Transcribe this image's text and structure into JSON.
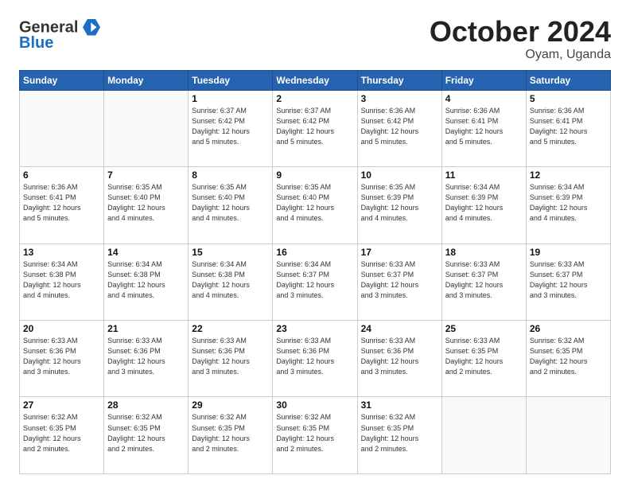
{
  "logo": {
    "text_general": "General",
    "text_blue": "Blue"
  },
  "header": {
    "month": "October 2024",
    "location": "Oyam, Uganda"
  },
  "days_of_week": [
    "Sunday",
    "Monday",
    "Tuesday",
    "Wednesday",
    "Thursday",
    "Friday",
    "Saturday"
  ],
  "weeks": [
    [
      {
        "day": "",
        "empty": true
      },
      {
        "day": "",
        "empty": true
      },
      {
        "day": "1",
        "sunrise": "Sunrise: 6:37 AM",
        "sunset": "Sunset: 6:42 PM",
        "daylight": "Daylight: 12 hours and 5 minutes."
      },
      {
        "day": "2",
        "sunrise": "Sunrise: 6:37 AM",
        "sunset": "Sunset: 6:42 PM",
        "daylight": "Daylight: 12 hours and 5 minutes."
      },
      {
        "day": "3",
        "sunrise": "Sunrise: 6:36 AM",
        "sunset": "Sunset: 6:42 PM",
        "daylight": "Daylight: 12 hours and 5 minutes."
      },
      {
        "day": "4",
        "sunrise": "Sunrise: 6:36 AM",
        "sunset": "Sunset: 6:41 PM",
        "daylight": "Daylight: 12 hours and 5 minutes."
      },
      {
        "day": "5",
        "sunrise": "Sunrise: 6:36 AM",
        "sunset": "Sunset: 6:41 PM",
        "daylight": "Daylight: 12 hours and 5 minutes."
      }
    ],
    [
      {
        "day": "6",
        "sunrise": "Sunrise: 6:36 AM",
        "sunset": "Sunset: 6:41 PM",
        "daylight": "Daylight: 12 hours and 5 minutes."
      },
      {
        "day": "7",
        "sunrise": "Sunrise: 6:35 AM",
        "sunset": "Sunset: 6:40 PM",
        "daylight": "Daylight: 12 hours and 4 minutes."
      },
      {
        "day": "8",
        "sunrise": "Sunrise: 6:35 AM",
        "sunset": "Sunset: 6:40 PM",
        "daylight": "Daylight: 12 hours and 4 minutes."
      },
      {
        "day": "9",
        "sunrise": "Sunrise: 6:35 AM",
        "sunset": "Sunset: 6:40 PM",
        "daylight": "Daylight: 12 hours and 4 minutes."
      },
      {
        "day": "10",
        "sunrise": "Sunrise: 6:35 AM",
        "sunset": "Sunset: 6:39 PM",
        "daylight": "Daylight: 12 hours and 4 minutes."
      },
      {
        "day": "11",
        "sunrise": "Sunrise: 6:34 AM",
        "sunset": "Sunset: 6:39 PM",
        "daylight": "Daylight: 12 hours and 4 minutes."
      },
      {
        "day": "12",
        "sunrise": "Sunrise: 6:34 AM",
        "sunset": "Sunset: 6:39 PM",
        "daylight": "Daylight: 12 hours and 4 minutes."
      }
    ],
    [
      {
        "day": "13",
        "sunrise": "Sunrise: 6:34 AM",
        "sunset": "Sunset: 6:38 PM",
        "daylight": "Daylight: 12 hours and 4 minutes."
      },
      {
        "day": "14",
        "sunrise": "Sunrise: 6:34 AM",
        "sunset": "Sunset: 6:38 PM",
        "daylight": "Daylight: 12 hours and 4 minutes."
      },
      {
        "day": "15",
        "sunrise": "Sunrise: 6:34 AM",
        "sunset": "Sunset: 6:38 PM",
        "daylight": "Daylight: 12 hours and 4 minutes."
      },
      {
        "day": "16",
        "sunrise": "Sunrise: 6:34 AM",
        "sunset": "Sunset: 6:37 PM",
        "daylight": "Daylight: 12 hours and 3 minutes."
      },
      {
        "day": "17",
        "sunrise": "Sunrise: 6:33 AM",
        "sunset": "Sunset: 6:37 PM",
        "daylight": "Daylight: 12 hours and 3 minutes."
      },
      {
        "day": "18",
        "sunrise": "Sunrise: 6:33 AM",
        "sunset": "Sunset: 6:37 PM",
        "daylight": "Daylight: 12 hours and 3 minutes."
      },
      {
        "day": "19",
        "sunrise": "Sunrise: 6:33 AM",
        "sunset": "Sunset: 6:37 PM",
        "daylight": "Daylight: 12 hours and 3 minutes."
      }
    ],
    [
      {
        "day": "20",
        "sunrise": "Sunrise: 6:33 AM",
        "sunset": "Sunset: 6:36 PM",
        "daylight": "Daylight: 12 hours and 3 minutes."
      },
      {
        "day": "21",
        "sunrise": "Sunrise: 6:33 AM",
        "sunset": "Sunset: 6:36 PM",
        "daylight": "Daylight: 12 hours and 3 minutes."
      },
      {
        "day": "22",
        "sunrise": "Sunrise: 6:33 AM",
        "sunset": "Sunset: 6:36 PM",
        "daylight": "Daylight: 12 hours and 3 minutes."
      },
      {
        "day": "23",
        "sunrise": "Sunrise: 6:33 AM",
        "sunset": "Sunset: 6:36 PM",
        "daylight": "Daylight: 12 hours and 3 minutes."
      },
      {
        "day": "24",
        "sunrise": "Sunrise: 6:33 AM",
        "sunset": "Sunset: 6:36 PM",
        "daylight": "Daylight: 12 hours and 3 minutes."
      },
      {
        "day": "25",
        "sunrise": "Sunrise: 6:33 AM",
        "sunset": "Sunset: 6:35 PM",
        "daylight": "Daylight: 12 hours and 2 minutes."
      },
      {
        "day": "26",
        "sunrise": "Sunrise: 6:32 AM",
        "sunset": "Sunset: 6:35 PM",
        "daylight": "Daylight: 12 hours and 2 minutes."
      }
    ],
    [
      {
        "day": "27",
        "sunrise": "Sunrise: 6:32 AM",
        "sunset": "Sunset: 6:35 PM",
        "daylight": "Daylight: 12 hours and 2 minutes."
      },
      {
        "day": "28",
        "sunrise": "Sunrise: 6:32 AM",
        "sunset": "Sunset: 6:35 PM",
        "daylight": "Daylight: 12 hours and 2 minutes."
      },
      {
        "day": "29",
        "sunrise": "Sunrise: 6:32 AM",
        "sunset": "Sunset: 6:35 PM",
        "daylight": "Daylight: 12 hours and 2 minutes."
      },
      {
        "day": "30",
        "sunrise": "Sunrise: 6:32 AM",
        "sunset": "Sunset: 6:35 PM",
        "daylight": "Daylight: 12 hours and 2 minutes."
      },
      {
        "day": "31",
        "sunrise": "Sunrise: 6:32 AM",
        "sunset": "Sunset: 6:35 PM",
        "daylight": "Daylight: 12 hours and 2 minutes."
      },
      {
        "day": "",
        "empty": true
      },
      {
        "day": "",
        "empty": true
      }
    ]
  ]
}
